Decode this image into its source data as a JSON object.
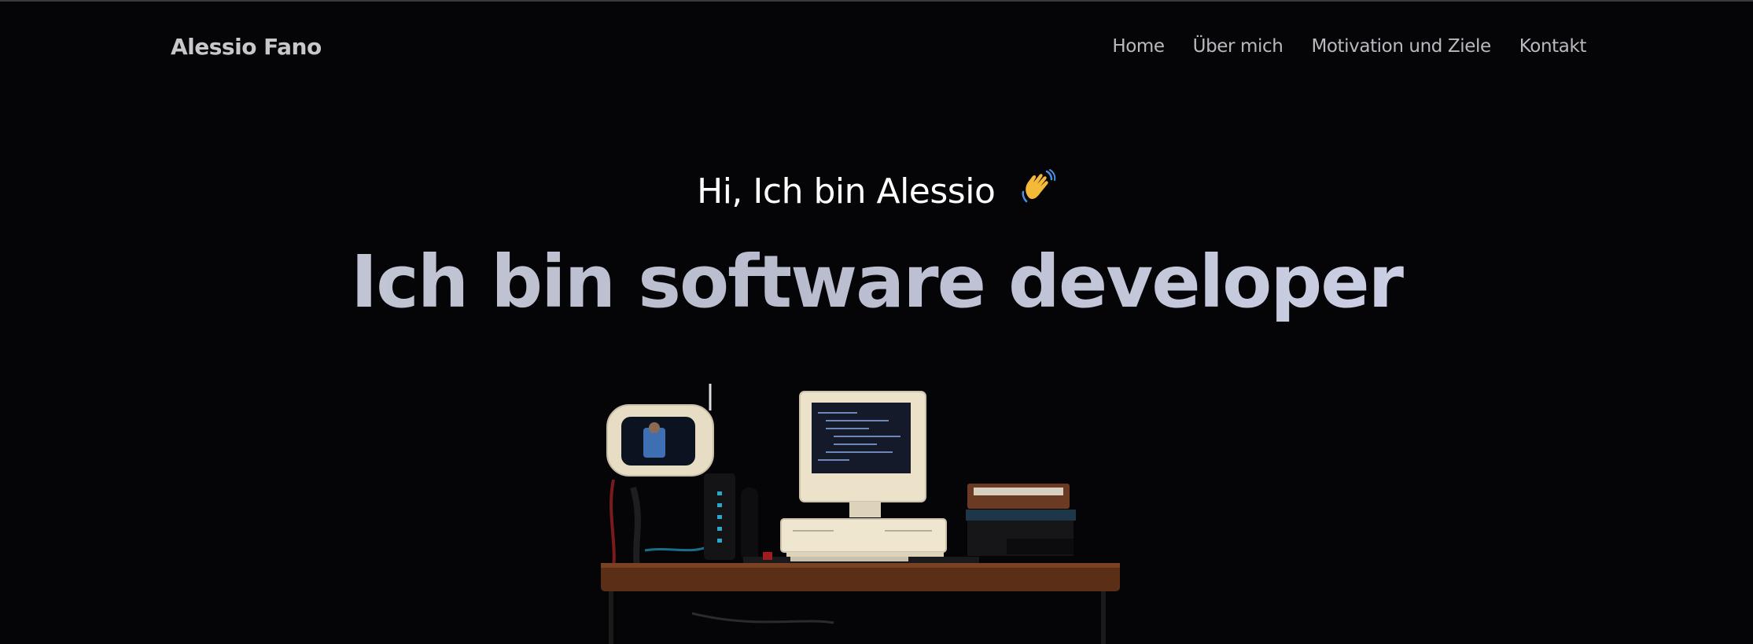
{
  "brand": "Alessio Fano",
  "nav": {
    "items": [
      {
        "label": "Home"
      },
      {
        "label": "Über mich"
      },
      {
        "label": "Motivation und Ziele"
      },
      {
        "label": "Kontakt"
      }
    ]
  },
  "hero": {
    "greeting": "Hi, Ich bin Alessio",
    "greeting_icon": "waving-hand-icon",
    "headline": "Ich bin software developer"
  },
  "colors": {
    "background": "#050508",
    "nav_text": "#b9b9c0",
    "headline_start": "#c9ccd8",
    "headline_end": "#d7daf0"
  }
}
